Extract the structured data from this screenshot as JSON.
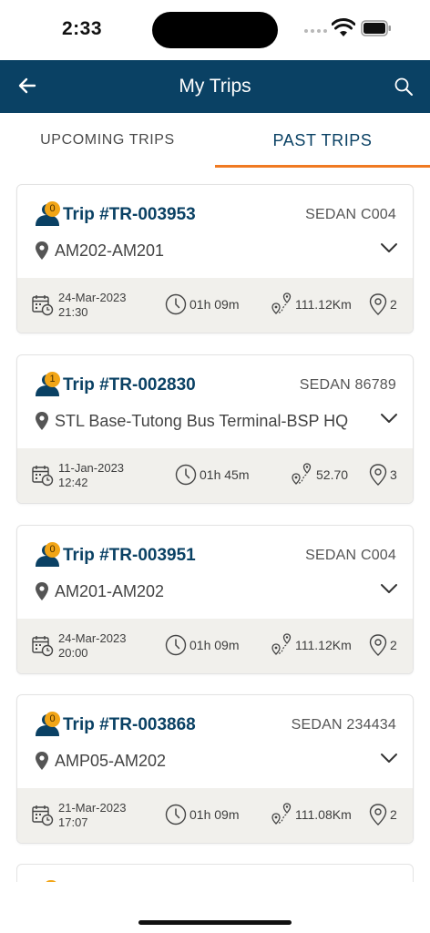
{
  "status_bar": {
    "time": "2:33"
  },
  "app_bar": {
    "title": "My Trips"
  },
  "tabs": [
    {
      "label": "UPCOMING TRIPS",
      "active": false
    },
    {
      "label": "PAST TRIPS",
      "active": true
    }
  ],
  "colors": {
    "primary": "#0a4164",
    "accent": "#f07a22",
    "badge": "#f2a516",
    "details_bg": "#f1f0ec"
  },
  "icons": [
    "back-arrow-icon",
    "search-icon",
    "passenger-icon",
    "location-pin-icon",
    "chevron-down-icon",
    "calendar-clock-icon",
    "clock-icon",
    "route-icon",
    "stops-pin-icon"
  ],
  "trips": [
    {
      "badge": "0",
      "trip_id": "Trip #TR-003953",
      "vehicle": "SEDAN C004",
      "route": "AM202-AM201",
      "date": "24-Mar-2023",
      "time": "21:30",
      "duration": "01h 09m",
      "distance": "111.12Km",
      "stops": "2"
    },
    {
      "badge": "1",
      "trip_id": "Trip #TR-002830",
      "vehicle": "SEDAN 86789",
      "route": "STL Base-Tutong Bus Terminal-BSP HQ",
      "date": "11-Jan-2023",
      "time": "12:42",
      "duration": "01h 45m",
      "distance": "52.70",
      "stops": "3"
    },
    {
      "badge": "0",
      "trip_id": "Trip #TR-003951",
      "vehicle": "SEDAN C004",
      "route": "AM201-AM202",
      "date": "24-Mar-2023",
      "time": "20:00",
      "duration": "01h 09m",
      "distance": "111.12Km",
      "stops": "2"
    },
    {
      "badge": "0",
      "trip_id": "Trip #TR-003868",
      "vehicle": "SEDAN 234434",
      "route": "AMP05-AM202",
      "date": "21-Mar-2023",
      "time": "17:07",
      "duration": "01h 09m",
      "distance": "111.08Km",
      "stops": "2"
    }
  ]
}
